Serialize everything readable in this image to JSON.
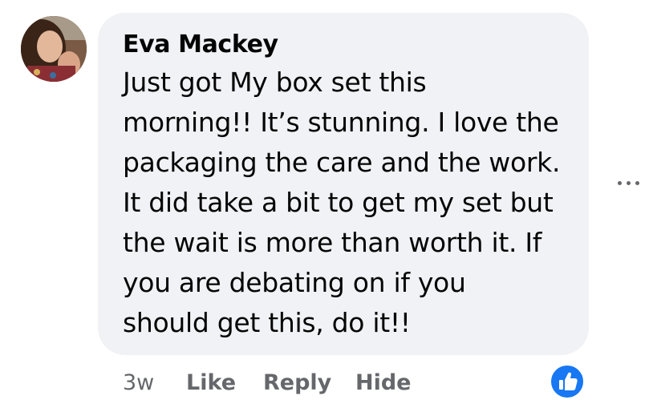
{
  "comment": {
    "author": "Eva Mackey",
    "text": "Just got My box set this\nmorning!! It’s stunning. I love the\npackaging the care and the work.\nIt did take a bit to get my set but\nthe wait is more than worth it. If\nyou are debating on if you\nshould get this, do it!!",
    "avatar_icon": "profile-photo",
    "more_icon": "more-horizontal-icon",
    "actions": {
      "time": "3w",
      "like": "Like",
      "reply": "Reply",
      "hide": "Hide"
    },
    "reaction_icon": "thumbs-up-icon"
  },
  "colors": {
    "bubble": "#f0f2f5",
    "text": "#050505",
    "secondary": "#65676b",
    "like_blue": "#1877f2"
  }
}
